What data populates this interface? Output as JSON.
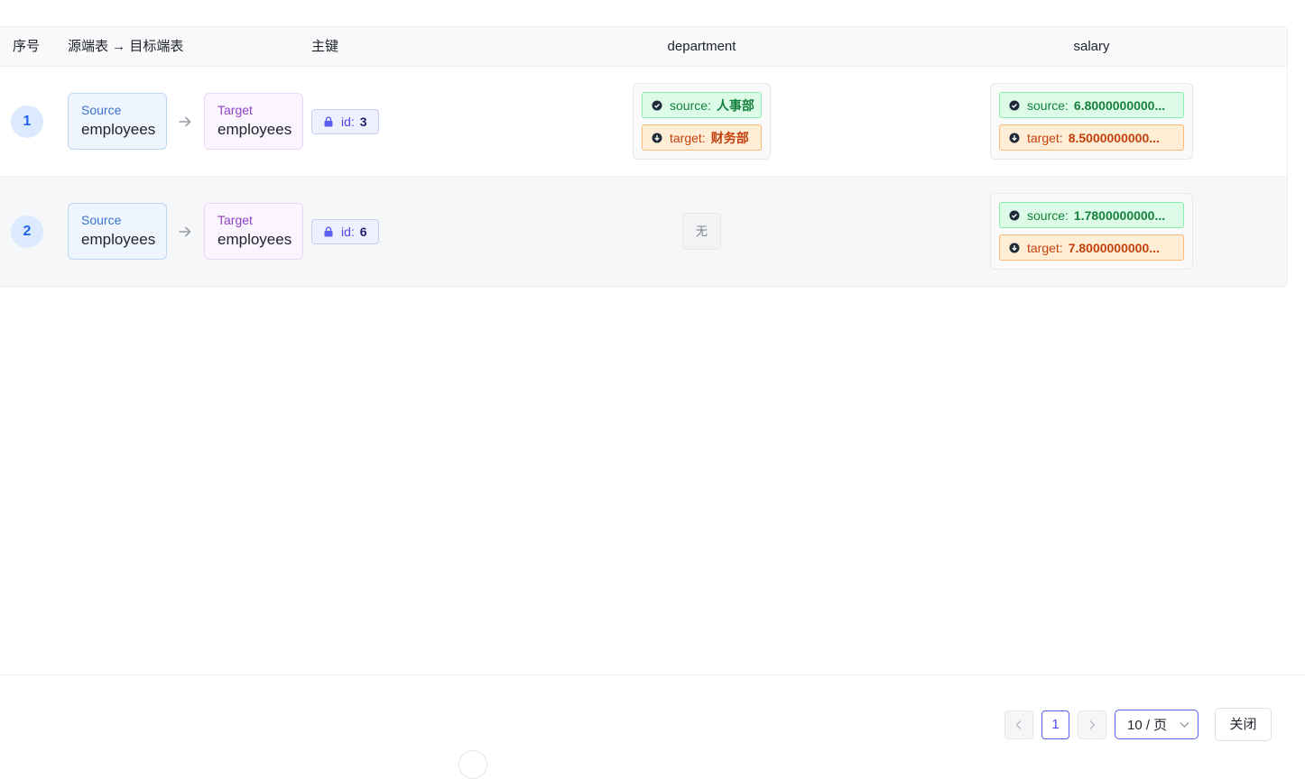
{
  "table": {
    "headers": {
      "index": "序号",
      "source_target": "源端表 → 目标端表",
      "primary_key": "主键",
      "col1": "department",
      "col2": "salary"
    },
    "rows": [
      {
        "index": "1",
        "source_kind": "Source",
        "source_table": "employees",
        "target_kind": "Target",
        "target_table": "employees",
        "pk_label": "id:",
        "pk_value": "3",
        "department": {
          "src_label": "source:",
          "src_value": "人事部",
          "tgt_label": "target:",
          "tgt_value": "财务部"
        },
        "salary": {
          "src_label": "source:",
          "src_value": "6.8000000000...",
          "tgt_label": "target:",
          "tgt_value": "8.5000000000..."
        }
      },
      {
        "index": "2",
        "source_kind": "Source",
        "source_table": "employees",
        "target_kind": "Target",
        "target_table": "employees",
        "pk_label": "id:",
        "pk_value": "6",
        "department_empty": "无",
        "salary": {
          "src_label": "source:",
          "src_value": "1.7800000000...",
          "tgt_label": "target:",
          "tgt_value": "7.8000000000..."
        }
      }
    ]
  },
  "pagination": {
    "prev_icon": "chevron-left-icon",
    "current_page": "1",
    "next_icon": "chevron-right-icon",
    "page_size": "10 / 页"
  },
  "footer": {
    "close_label": "关闭"
  },
  "colors": {
    "accent": "#5b5ff0",
    "source_green": "#15803d",
    "target_orange": "#c2410c",
    "index_blue": "#2563eb"
  }
}
